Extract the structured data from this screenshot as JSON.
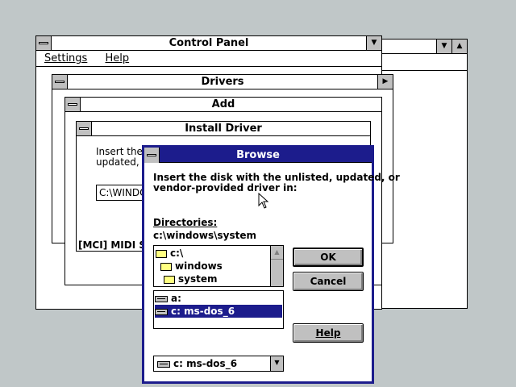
{
  "control_panel": {
    "title": "Control Panel",
    "menu": [
      "Settings",
      "Help"
    ]
  },
  "drivers": {
    "title": "Drivers"
  },
  "add": {
    "title": "Add"
  },
  "install_driver": {
    "title": "Install Driver",
    "text_line1": "Insert the",
    "text_line2": "updated, o",
    "path_value": "C:\\WINDO",
    "list_item": "[MCI] MIDI Se"
  },
  "browse": {
    "title": "Browse",
    "instruction_line1": "Insert the disk with the unlisted, updated, or",
    "instruction_line2": "vendor-provided driver in:",
    "directories_label": "Directories:",
    "current_path": "c:\\windows\\system",
    "dirs": [
      "c:\\",
      "windows",
      "system"
    ],
    "drives": [
      "a:",
      "c: ms-dos_6"
    ],
    "selected_drive": "c: ms-dos_6",
    "ok_label": "OK",
    "cancel_label": "Cancel",
    "help_label": "Help"
  },
  "icons": {
    "down": "▼",
    "up": "▲",
    "scroll_up": "▲",
    "scroll_down": "▼"
  }
}
